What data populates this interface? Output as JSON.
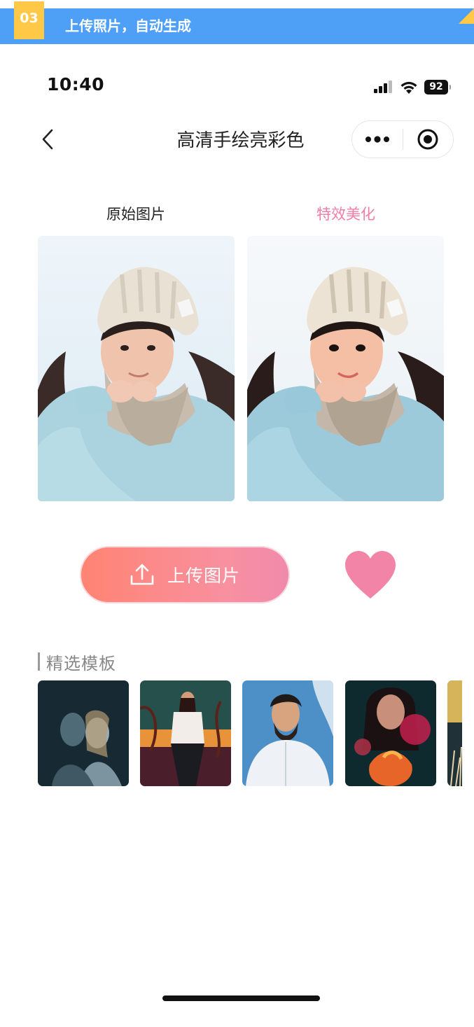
{
  "promo": {
    "step": "03",
    "text": "上传照片，自动生成"
  },
  "status_bar": {
    "time": "10:40",
    "battery": "92"
  },
  "nav": {
    "title": "高清手绘亮彩色"
  },
  "compare": {
    "original_label": "原始图片",
    "effect_label": "特效美化"
  },
  "actions": {
    "upload_label": "上传图片"
  },
  "templates": {
    "title": "精选模板",
    "items": [
      "template-1",
      "template-2",
      "template-3",
      "template-4",
      "template-5"
    ]
  },
  "colors": {
    "banner": "#4da0f5",
    "step_badge": "#ffc947",
    "accent_pink": "#f07ea7",
    "upload_gradient_start": "#ff8472",
    "upload_gradient_end": "#f08aab",
    "heart": "#f284a8"
  }
}
